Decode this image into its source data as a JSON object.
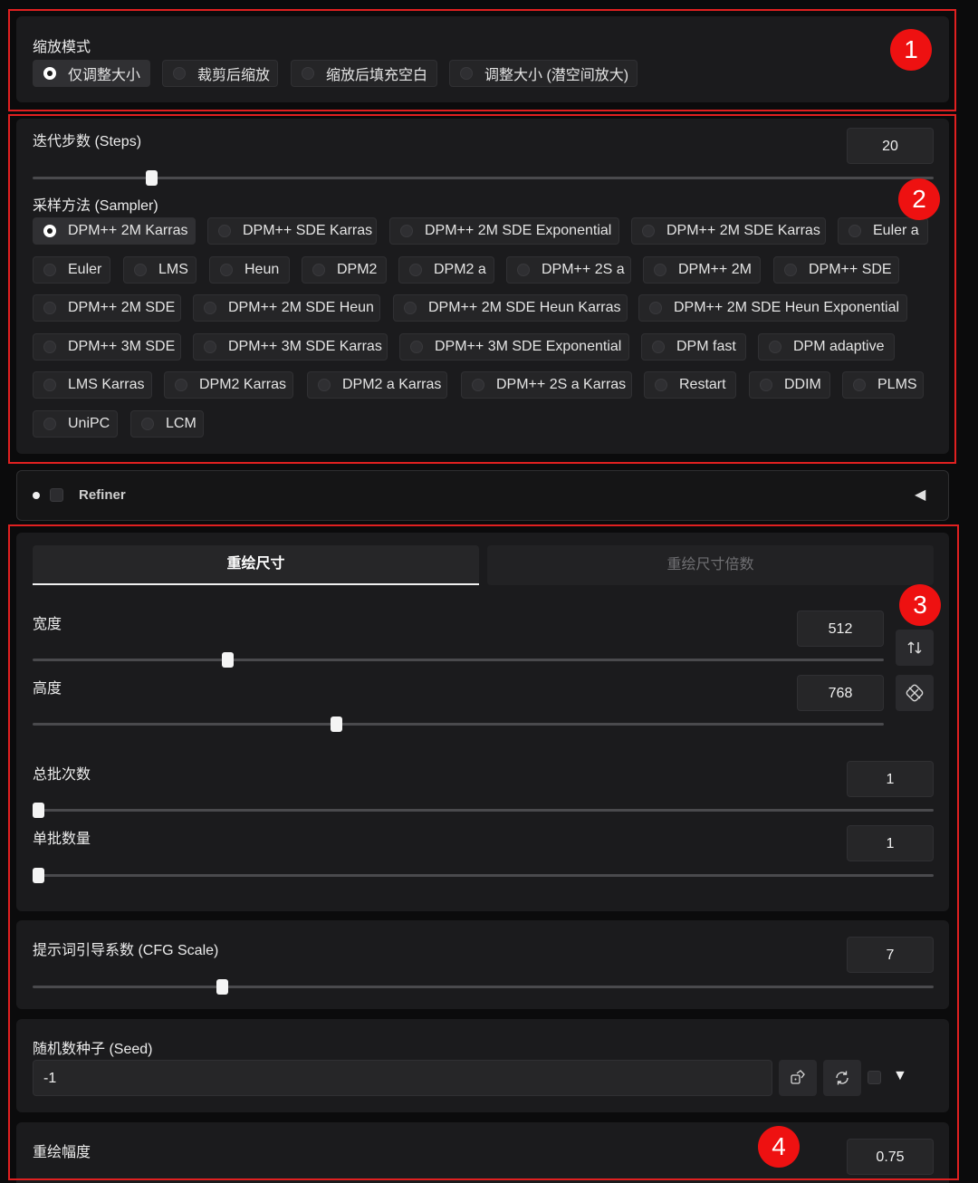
{
  "resize_mode": {
    "label": "缩放模式",
    "options": [
      "仅调整大小",
      "裁剪后缩放",
      "缩放后填充空白",
      "调整大小 (潜空间放大)"
    ],
    "selected": "仅调整大小"
  },
  "steps": {
    "label": "迭代步数 (Steps)",
    "value": "20",
    "slider_fraction": 0.13
  },
  "sampler": {
    "label": "采样方法 (Sampler)",
    "selected": "DPM++ 2M Karras",
    "options": [
      "DPM++ 2M Karras",
      "DPM++ SDE Karras",
      "DPM++ 2M SDE Exponential",
      "DPM++ 2M SDE Karras",
      "Euler a",
      "Euler",
      "LMS",
      "Heun",
      "DPM2",
      "DPM2 a",
      "DPM++ 2S a",
      "DPM++ 2M",
      "DPM++ SDE",
      "DPM++ 2M SDE",
      "DPM++ 2M SDE Heun",
      "DPM++ 2M SDE Heun Karras",
      "DPM++ 2M SDE Heun Exponential",
      "DPM++ 3M SDE",
      "DPM++ 3M SDE Karras",
      "DPM++ 3M SDE Exponential",
      "DPM fast",
      "DPM adaptive",
      "LMS Karras",
      "DPM2 Karras",
      "DPM2 a Karras",
      "DPM++ 2S a Karras",
      "Restart",
      "DDIM",
      "PLMS",
      "UniPC",
      "LCM"
    ]
  },
  "refiner": {
    "label": "Refiner",
    "arrow": "◀"
  },
  "size_tabs": {
    "active": "重绘尺寸",
    "inactive": "重绘尺寸倍数"
  },
  "width": {
    "label": "宽度",
    "value": "512",
    "slider_fraction": 0.23
  },
  "height": {
    "label": "高度",
    "value": "768",
    "slider_fraction": 0.355
  },
  "batch_count": {
    "label": "总批次数",
    "value": "1",
    "slider_fraction": 0.0
  },
  "batch_size": {
    "label": "单批数量",
    "value": "1",
    "slider_fraction": 0.0
  },
  "cfg_scale": {
    "label": "提示词引导系数 (CFG Scale)",
    "value": "7",
    "slider_fraction": 0.21
  },
  "seed": {
    "label": "随机数种子 (Seed)",
    "value": "-1",
    "dropdown_arrow": "▼"
  },
  "denoise": {
    "label": "重绘幅度",
    "value": "0.75"
  },
  "annotations": {
    "b1": "1",
    "b2": "2",
    "b3": "3",
    "b4": "4",
    "color": "#ee1111"
  },
  "icons": {
    "swap": "swap-vertical-icon",
    "lock_ratio": "aspect-ratio-icon",
    "random": "dice-icon",
    "recycle": "recycle-icon",
    "refiner_dot": "dot-icon"
  }
}
